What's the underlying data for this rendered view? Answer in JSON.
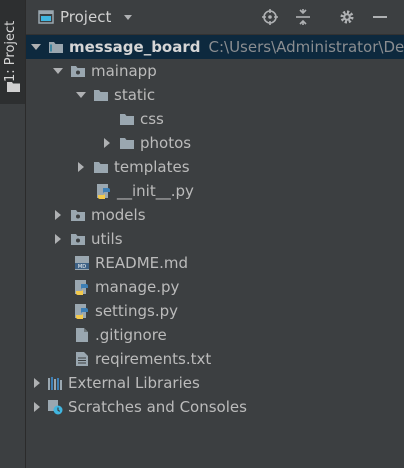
{
  "sidebar": {
    "tab_label": "1: Project"
  },
  "header": {
    "title": "Project"
  },
  "tree": {
    "root": {
      "name": "message_board",
      "path": "C:\\Users\\Administrator\\Des"
    },
    "mainapp": "mainapp",
    "static": "static",
    "css": "css",
    "photos": "photos",
    "templates": "templates",
    "init": "__init__.py",
    "models": "models",
    "utils": "utils",
    "readme": "README.md",
    "manage": "manage.py",
    "settings": "settings.py",
    "gitignore": ".gitignore",
    "requirements": "reqirements.txt",
    "external_libraries": "External Libraries",
    "scratches": "Scratches and Consoles"
  },
  "icons": {
    "folder": "folder-icon",
    "python": "python-file-icon",
    "markdown": "markdown-file-icon",
    "text": "text-file-icon",
    "library": "library-icon",
    "scratches": "scratches-icon"
  },
  "colors": {
    "background": "#3c3f41",
    "selection": "#0d293e",
    "text": "#bbbbbb",
    "folder": "#9aa7b0",
    "python_blue": "#3d7fb5",
    "python_yellow": "#f2c94c"
  }
}
